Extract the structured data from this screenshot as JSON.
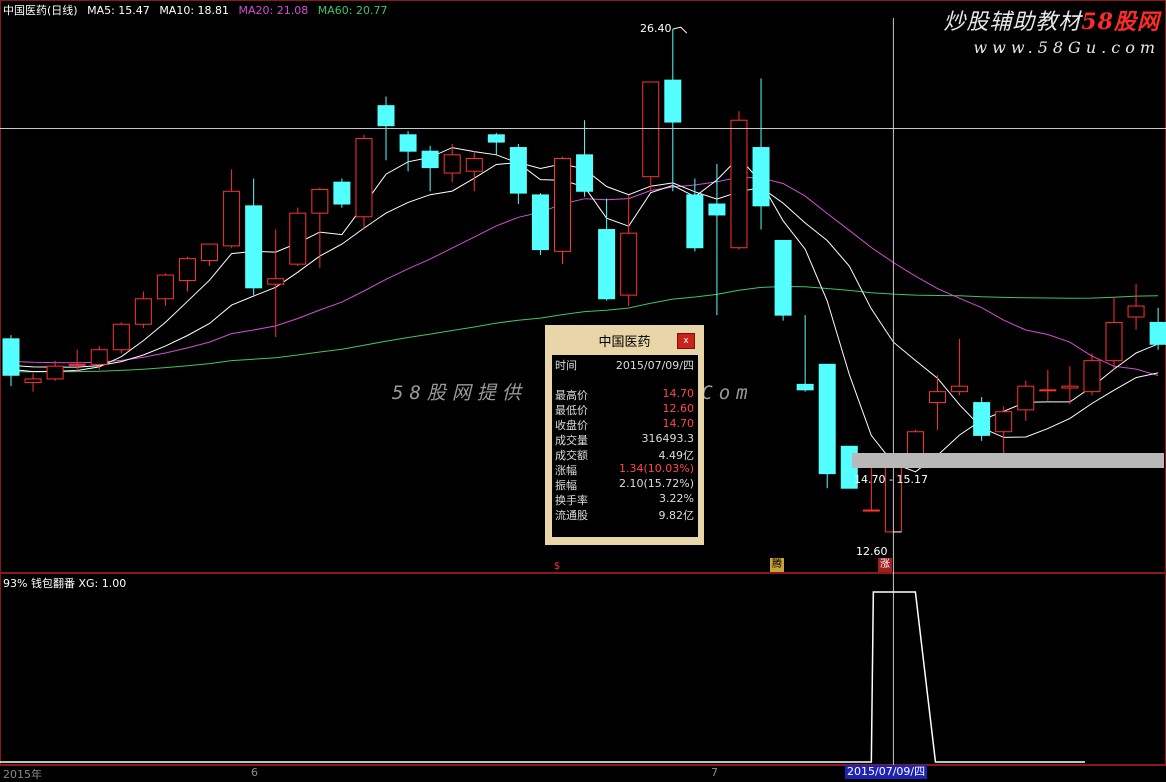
{
  "header": {
    "stock": "中国医药(日线)",
    "ma5": "MA5: 15.47",
    "ma10": "MA10: 18.81",
    "ma20": "MA20: 21.08",
    "ma60": "MA60: 20.77"
  },
  "colors": {
    "up": "#ff3232",
    "down": "#54ffff",
    "ma5": "#ffffff",
    "ma10": "#ffffff",
    "ma20": "#d24fd2",
    "ma60": "#3fc46a",
    "crosshair": "#c8c8c8"
  },
  "logo": {
    "line1_prefix": "炒股辅助教材",
    "line1_brand": "58股网",
    "line2": "www.58Gu.com"
  },
  "watermark": "58股网提供  Www.58GU.Com",
  "annotations": {
    "high_price": "26.40",
    "low_price": "12.60",
    "range": "14.70 - 15.17"
  },
  "popup": {
    "title": "中国医药",
    "close": "x",
    "rows": [
      {
        "k": "时间",
        "v": "2015/07/09/四",
        "red": false
      },
      {
        "k": "最高价",
        "v": "14.70",
        "red": true
      },
      {
        "k": "最低价",
        "v": "12.60",
        "red": true
      },
      {
        "k": "收盘价",
        "v": "14.70",
        "red": true
      },
      {
        "k": "成交量",
        "v": "316493.3",
        "red": false
      },
      {
        "k": "成交额",
        "v": "4.49亿",
        "red": false
      },
      {
        "k": "涨幅",
        "v": "1.34(10.03%)",
        "red": true
      },
      {
        "k": "振幅",
        "v": "2.10(15.72%)",
        "red": false
      },
      {
        "k": "换手率",
        "v": "3.22%",
        "red": false
      },
      {
        "k": "流通股",
        "v": "9.82亿",
        "red": false
      }
    ]
  },
  "indicator": {
    "label": "93% 钱包翻番  XG: 1.00"
  },
  "badges": [
    {
      "text": "$",
      "color": "#ff3232"
    },
    {
      "text": "腾",
      "color": "#c9a23a"
    },
    {
      "text": "涨",
      "color": "#a02020"
    }
  ],
  "xaxis": {
    "labels": [
      "2015年",
      "6",
      "7"
    ],
    "selected_date": "2015/07/09/四"
  },
  "chart_data": {
    "type": "candlestick",
    "y_range": [
      11.5,
      27.2
    ],
    "candles": [
      {
        "o": 17.9,
        "c": 16.9,
        "h": 18.0,
        "l": 16.6
      },
      {
        "o": 16.7,
        "c": 16.8,
        "h": 16.95,
        "l": 16.45
      },
      {
        "o": 16.8,
        "c": 17.15,
        "h": 17.3,
        "l": 16.75
      },
      {
        "o": 17.2,
        "c": 17.2,
        "h": 17.6,
        "l": 17.0
      },
      {
        "o": 17.2,
        "c": 17.6,
        "h": 17.7,
        "l": 17.05
      },
      {
        "o": 17.6,
        "c": 18.3,
        "h": 18.35,
        "l": 17.5
      },
      {
        "o": 18.3,
        "c": 19.0,
        "h": 19.2,
        "l": 18.2
      },
      {
        "o": 19.0,
        "c": 19.65,
        "h": 19.7,
        "l": 18.8
      },
      {
        "o": 19.5,
        "c": 20.1,
        "h": 20.15,
        "l": 19.2
      },
      {
        "o": 20.05,
        "c": 20.5,
        "h": 20.5,
        "l": 19.9
      },
      {
        "o": 20.45,
        "c": 21.95,
        "h": 22.55,
        "l": 20.4
      },
      {
        "o": 21.55,
        "c": 19.3,
        "h": 22.3,
        "l": 19.1
      },
      {
        "o": 19.4,
        "c": 19.55,
        "h": 20.9,
        "l": 17.95
      },
      {
        "o": 19.95,
        "c": 21.35,
        "h": 21.5,
        "l": 19.9
      },
      {
        "o": 21.35,
        "c": 22.0,
        "h": 22.05,
        "l": 19.85
      },
      {
        "o": 22.2,
        "c": 21.6,
        "h": 22.3,
        "l": 21.5
      },
      {
        "o": 21.25,
        "c": 23.4,
        "h": 23.5,
        "l": 20.9
      },
      {
        "o": 24.3,
        "c": 23.75,
        "h": 24.55,
        "l": 22.8
      },
      {
        "o": 23.5,
        "c": 23.05,
        "h": 23.6,
        "l": 22.5
      },
      {
        "o": 23.05,
        "c": 22.6,
        "h": 23.2,
        "l": 21.95
      },
      {
        "o": 22.45,
        "c": 22.95,
        "h": 23.25,
        "l": 22.2
      },
      {
        "o": 22.5,
        "c": 22.85,
        "h": 23.05,
        "l": 21.95
      },
      {
        "o": 23.5,
        "c": 23.3,
        "h": 23.55,
        "l": 22.95
      },
      {
        "o": 23.15,
        "c": 21.9,
        "h": 23.25,
        "l": 21.6
      },
      {
        "o": 21.85,
        "c": 20.35,
        "h": 21.9,
        "l": 20.2
      },
      {
        "o": 20.3,
        "c": 22.85,
        "h": 22.9,
        "l": 19.95
      },
      {
        "o": 22.95,
        "c": 21.95,
        "h": 23.9,
        "l": 21.8
      },
      {
        "o": 20.9,
        "c": 19.0,
        "h": 21.75,
        "l": 18.95
      },
      {
        "o": 19.1,
        "c": 20.8,
        "h": 21.85,
        "l": 18.8
      },
      {
        "o": 22.35,
        "c": 24.95,
        "h": 24.95,
        "l": 21.95
      },
      {
        "o": 25.0,
        "c": 23.85,
        "h": 26.4,
        "l": 21.95
      },
      {
        "o": 21.85,
        "c": 20.4,
        "h": 22.3,
        "l": 20.3
      },
      {
        "o": 21.6,
        "c": 21.3,
        "h": 22.7,
        "l": 18.55
      },
      {
        "o": 20.4,
        "c": 23.9,
        "h": 24.15,
        "l": 20.35
      },
      {
        "o": 23.15,
        "c": 21.55,
        "h": 25.05,
        "l": 20.9
      },
      {
        "o": 20.6,
        "c": 18.55,
        "h": 20.6,
        "l": 18.4
      },
      {
        "o": 16.65,
        "c": 16.5,
        "h": 18.55,
        "l": 16.45
      },
      {
        "o": 17.2,
        "c": 14.2,
        "h": 17.2,
        "l": 13.8
      },
      {
        "o": 14.95,
        "c": 13.8,
        "h": 14.95,
        "l": 13.8
      },
      {
        "o": 13.2,
        "c": 13.2,
        "h": 14.35,
        "l": 13.2
      },
      {
        "o": 12.6,
        "c": 14.7,
        "h": 14.7,
        "l": 12.6
      },
      {
        "o": 14.6,
        "c": 15.35,
        "h": 15.4,
        "l": 14.7
      },
      {
        "o": 16.15,
        "c": 16.45,
        "h": 16.9,
        "l": 15.4
      },
      {
        "o": 16.45,
        "c": 16.6,
        "h": 17.9,
        "l": 16.35
      },
      {
        "o": 16.15,
        "c": 15.25,
        "h": 16.3,
        "l": 15.1
      },
      {
        "o": 15.35,
        "c": 15.9,
        "h": 16.05,
        "l": 14.7
      },
      {
        "o": 15.95,
        "c": 16.6,
        "h": 16.75,
        "l": 15.65
      },
      {
        "o": 16.5,
        "c": 16.5,
        "h": 17.05,
        "l": 16.2
      },
      {
        "o": 16.55,
        "c": 16.6,
        "h": 17.15,
        "l": 16.1
      },
      {
        "o": 16.45,
        "c": 17.3,
        "h": 17.5,
        "l": 16.35
      },
      {
        "o": 17.3,
        "c": 18.35,
        "h": 19.05,
        "l": 17.05
      },
      {
        "o": 18.5,
        "c": 18.8,
        "h": 19.4,
        "l": 18.15
      },
      {
        "o": 18.35,
        "c": 17.75,
        "h": 18.75,
        "l": 17.6
      }
    ],
    "ma_values": {
      "MA5": 15.47,
      "MA10": 18.81,
      "MA20": 21.08,
      "MA60": 20.77
    },
    "indicator": {
      "name": "XG",
      "value": 1.0
    }
  }
}
